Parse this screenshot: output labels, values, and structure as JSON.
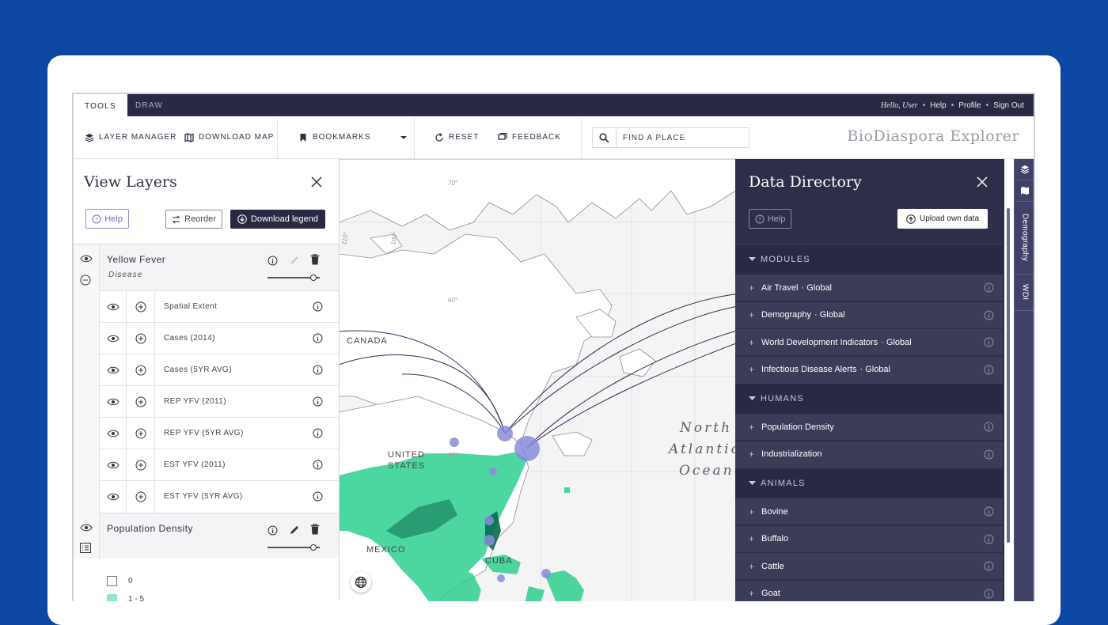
{
  "topbar": {
    "tabs": [
      {
        "label": "TOOLS"
      },
      {
        "label": "DRAW"
      }
    ],
    "greeting": "Hello, User",
    "links": [
      "Help",
      "Profile",
      "Sign Out"
    ]
  },
  "toolbar": {
    "layer_manager": "LAYER MANAGER",
    "download_map": "DOWNLOAD MAP",
    "bookmarks": "BOOKMARKS",
    "reset": "RESET",
    "feedback": "FEEDBACK",
    "find_placeholder": "FIND A PLACE",
    "brand": "BioDiaspora Explorer"
  },
  "view_layers": {
    "title": "View Layers",
    "help": "Help",
    "reorder": "Reorder",
    "download_legend": "Download legend",
    "layers": [
      {
        "name": "Yellow Fever",
        "subtitle": "Disease",
        "opacity": 0.85,
        "sublayers": [
          "Spatial Extent",
          "Cases (2014)",
          "Cases (5YR AVG)",
          "REP YFV (2011)",
          "REP YFV (5YR AVG)",
          "EST YFV (2011)",
          "EST YFV (5YR AVG)"
        ]
      },
      {
        "name": "Population Density",
        "opacity": 0.85,
        "legend": [
          {
            "label": "0",
            "color": "#ffffff"
          },
          {
            "label": "1 - 5",
            "color": "#8fe8c0"
          }
        ]
      }
    ]
  },
  "map": {
    "labels": {
      "canada": "CANADA",
      "us1": "UNITED",
      "us2": "STATES",
      "mexico": "MEXICO",
      "cuba": "CUBA",
      "ocean1": "North",
      "ocean2": "Atlantic",
      "ocean3": "Ocean"
    },
    "graticule": [
      "70°",
      "60°",
      "40°",
      "100°",
      "110°"
    ],
    "colors": {
      "arc": "#2c2e54",
      "node": "#8a8cdc",
      "density": "#2ed08f"
    }
  },
  "data_directory": {
    "title": "Data Directory",
    "help": "Help",
    "upload": "Upload own data",
    "sections": [
      {
        "title": "MODULES",
        "items": [
          {
            "name": "Air Travel",
            "region": "· Global"
          },
          {
            "name": "Demography",
            "region": "· Global"
          },
          {
            "name": "World Development Indicators",
            "region": "· Global"
          },
          {
            "name": "Infectious Disease Alerts",
            "region": "· Global"
          }
        ]
      },
      {
        "title": "HUMANS",
        "items": [
          {
            "name": "Population Density"
          },
          {
            "name": "Industrialization"
          }
        ]
      },
      {
        "title": "ANIMALS",
        "items": [
          {
            "name": "Bovine"
          },
          {
            "name": "Buffalo"
          },
          {
            "name": "Cattle"
          },
          {
            "name": "Goat"
          }
        ]
      }
    ]
  },
  "rail": {
    "tabs": [
      "Demography",
      "WDI"
    ]
  }
}
